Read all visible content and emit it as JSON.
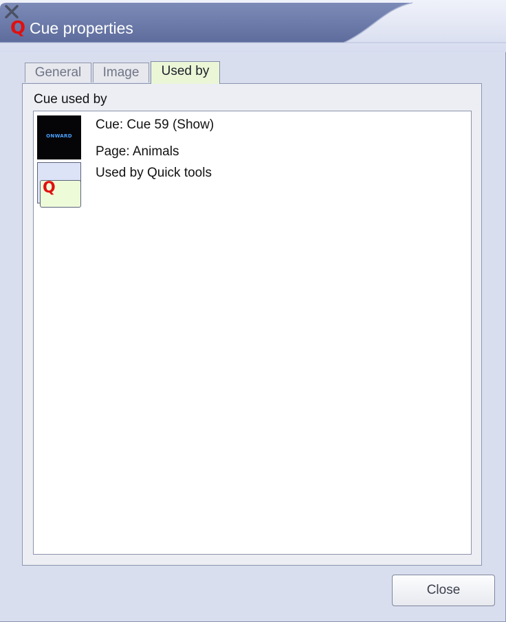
{
  "window": {
    "title": "Cue properties",
    "app_icon_glyph": "Q",
    "close_glyph": "✕"
  },
  "tabs": [
    {
      "label": "General",
      "active": false
    },
    {
      "label": "Image",
      "active": false
    },
    {
      "label": "Used by",
      "active": true
    }
  ],
  "panel": {
    "section_label": "Cue used by",
    "items": [
      {
        "icon": "show-cue-thumbnail",
        "thumb_text": "ONWARD",
        "lines": [
          "Cue: Cue 59 (Show)",
          "Page: Animals"
        ]
      },
      {
        "icon": "quick-tools-icon",
        "thumb_text": "Q",
        "lines": [
          "Used by Quick tools"
        ]
      }
    ]
  },
  "footer": {
    "close_label": "Close"
  },
  "colors": {
    "titlebar_dark": "#6a78a6",
    "titlebar_light": "#e4e8f6",
    "window_bg": "#d9deef",
    "active_tab_bg": "#eaf6d6",
    "accent_red": "#e01010"
  }
}
